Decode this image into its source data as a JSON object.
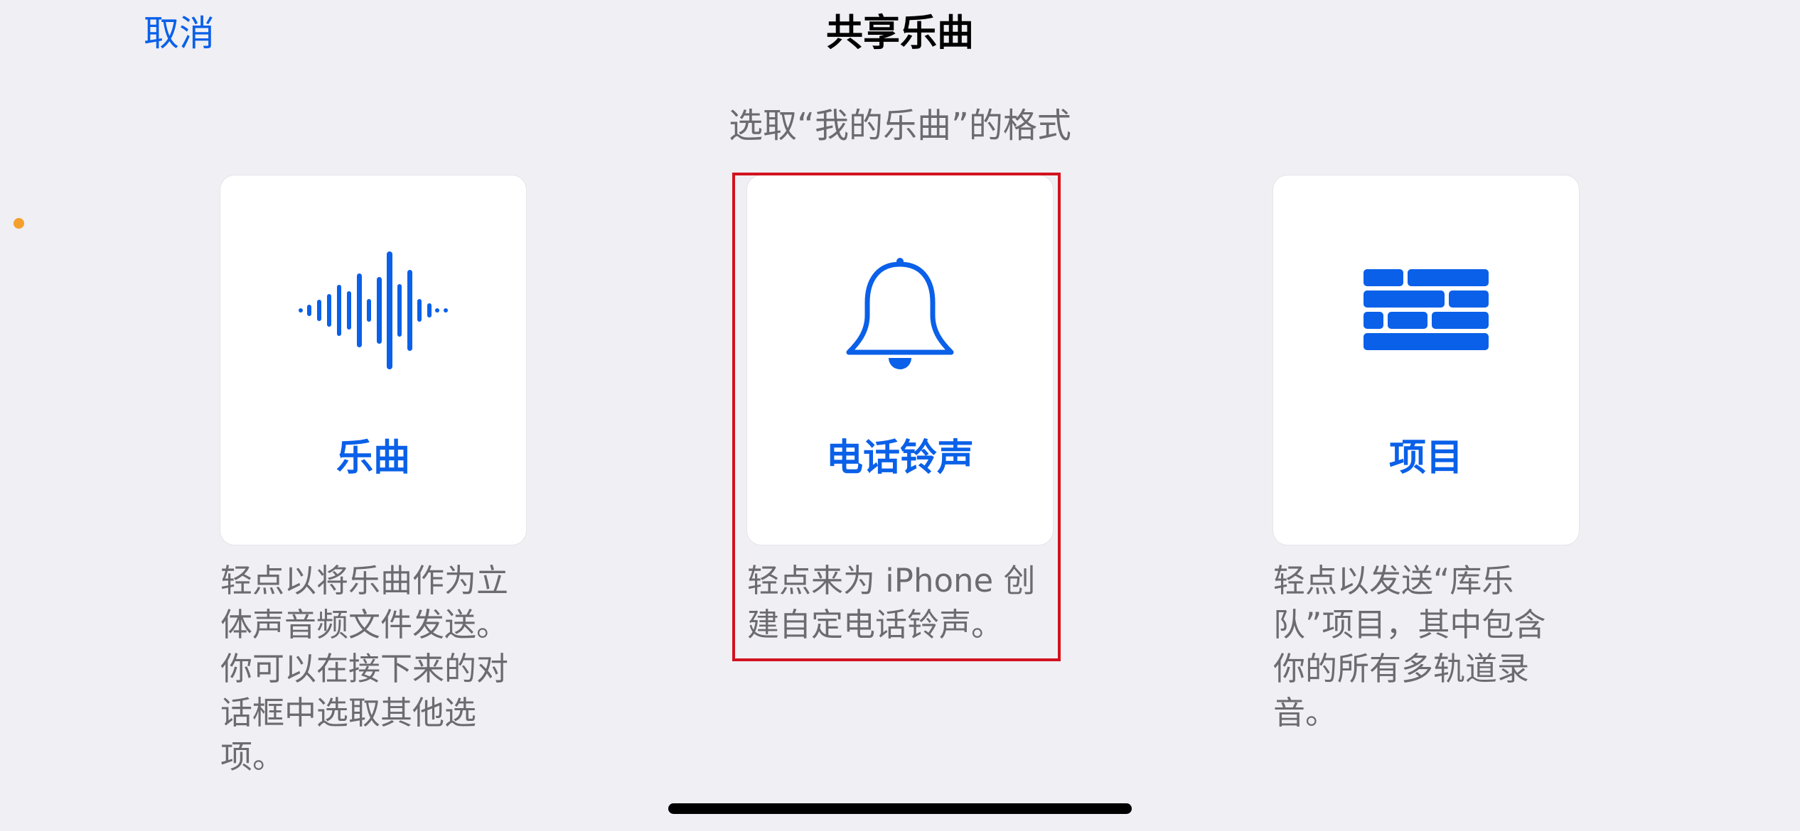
{
  "nav": {
    "cancel_label": "取消",
    "title": "共享乐曲"
  },
  "subtitle": "选取“我的乐曲”的格式",
  "options": [
    {
      "label": "乐曲",
      "icon": "waveform-icon",
      "description": "轻点以将乐曲作为立体声音频文件发送。你可以在接下来的对话框中选取其他选项。"
    },
    {
      "label": "电话铃声",
      "icon": "bell-icon",
      "description": "轻点来为 iPhone 创建自定电话铃声。",
      "highlighted": true
    },
    {
      "label": "项目",
      "icon": "brick-wall-icon",
      "description": "轻点以发送“库乐队”项目，其中包含你的所有多轨道录音。"
    }
  ],
  "colors": {
    "accent": "#0a60e8",
    "background": "#efeff4",
    "highlight_border": "#d2121e",
    "indicator_dot": "#f4a02c"
  }
}
